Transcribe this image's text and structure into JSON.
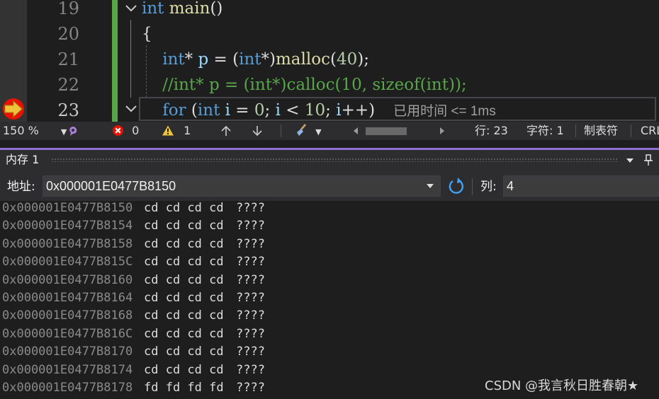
{
  "editor": {
    "lines": [
      {
        "num": "19",
        "tokens": [
          {
            "c": "kw",
            "t": "int"
          },
          {
            "c": "pl",
            "t": " "
          },
          {
            "c": "fn",
            "t": "main"
          },
          {
            "c": "pl",
            "t": "()"
          }
        ]
      },
      {
        "num": "20",
        "tokens": [
          {
            "c": "pl",
            "t": "{"
          }
        ]
      },
      {
        "num": "21",
        "tokens": [
          {
            "c": "pl",
            "t": "    "
          },
          {
            "c": "kw",
            "t": "int"
          },
          {
            "c": "pl",
            "t": "* "
          },
          {
            "c": "id",
            "t": "p"
          },
          {
            "c": "pl",
            "t": " = ("
          },
          {
            "c": "kw",
            "t": "int"
          },
          {
            "c": "pl",
            "t": "*)"
          },
          {
            "c": "fn",
            "t": "malloc"
          },
          {
            "c": "pl",
            "t": "("
          },
          {
            "c": "num",
            "t": "40"
          },
          {
            "c": "pl",
            "t": ");"
          }
        ]
      },
      {
        "num": "22",
        "tokens": [
          {
            "c": "pl",
            "t": "    "
          },
          {
            "c": "cm",
            "t": "//int* p = (int*)calloc(10, sizeof(int));"
          }
        ]
      },
      {
        "num": "23",
        "tokens": [
          {
            "c": "pl",
            "t": "    "
          },
          {
            "c": "kw",
            "t": "for"
          },
          {
            "c": "pl",
            "t": " ("
          },
          {
            "c": "kw",
            "t": "int"
          },
          {
            "c": "pl",
            "t": " "
          },
          {
            "c": "id",
            "t": "i"
          },
          {
            "c": "pl",
            "t": " = "
          },
          {
            "c": "num",
            "t": "0"
          },
          {
            "c": "pl",
            "t": "; "
          },
          {
            "c": "id",
            "t": "i"
          },
          {
            "c": "pl",
            "t": " < "
          },
          {
            "c": "num",
            "t": "10"
          },
          {
            "c": "pl",
            "t": "; "
          },
          {
            "c": "id",
            "t": "i"
          },
          {
            "c": "pl",
            "t": "++)"
          }
        ]
      }
    ],
    "elapsed_hint": "已用时间 <= 1ms"
  },
  "status_bar": {
    "zoom": "150 %",
    "errors": "0",
    "warnings": "1",
    "line_info": "行: 23",
    "char_info": "字符: 1",
    "tab_mode": "制表符",
    "line_ending": "CRL"
  },
  "memory_panel": {
    "title": "内存 1",
    "address_label": "地址:",
    "address_value": "0x000001E0477B8150",
    "columns_label": "列:",
    "columns_value": "4",
    "rows": [
      {
        "addr": "0x000001E0477B8150",
        "bytes": "cd cd cd cd",
        "ascii": "????"
      },
      {
        "addr": "0x000001E0477B8154",
        "bytes": "cd cd cd cd",
        "ascii": "????"
      },
      {
        "addr": "0x000001E0477B8158",
        "bytes": "cd cd cd cd",
        "ascii": "????"
      },
      {
        "addr": "0x000001E0477B815C",
        "bytes": "cd cd cd cd",
        "ascii": "????"
      },
      {
        "addr": "0x000001E0477B8160",
        "bytes": "cd cd cd cd",
        "ascii": "????"
      },
      {
        "addr": "0x000001E0477B8164",
        "bytes": "cd cd cd cd",
        "ascii": "????"
      },
      {
        "addr": "0x000001E0477B8168",
        "bytes": "cd cd cd cd",
        "ascii": "????"
      },
      {
        "addr": "0x000001E0477B816C",
        "bytes": "cd cd cd cd",
        "ascii": "????"
      },
      {
        "addr": "0x000001E0477B8170",
        "bytes": "cd cd cd cd",
        "ascii": "????"
      },
      {
        "addr": "0x000001E0477B8174",
        "bytes": "cd cd cd cd",
        "ascii": "????"
      },
      {
        "addr": "0x000001E0477B8178",
        "bytes": "fd fd fd fd",
        "ascii": "????"
      }
    ]
  },
  "watermark": "CSDN @我言秋日胜春朝★",
  "icons": {
    "breakpoint_arrow": "current-statement-arrow-icon",
    "error": "error-icon",
    "warning": "warning-icon",
    "refresh": "refresh-icon"
  },
  "colors": {
    "accent": "#8f6fd4",
    "change_bar": "#57a64a",
    "keyword": "#569cd6",
    "function": "#dcdcaa",
    "comment": "#57a64a",
    "number": "#b5cea8",
    "error": "#e51400",
    "warning": "#f0c43a"
  }
}
